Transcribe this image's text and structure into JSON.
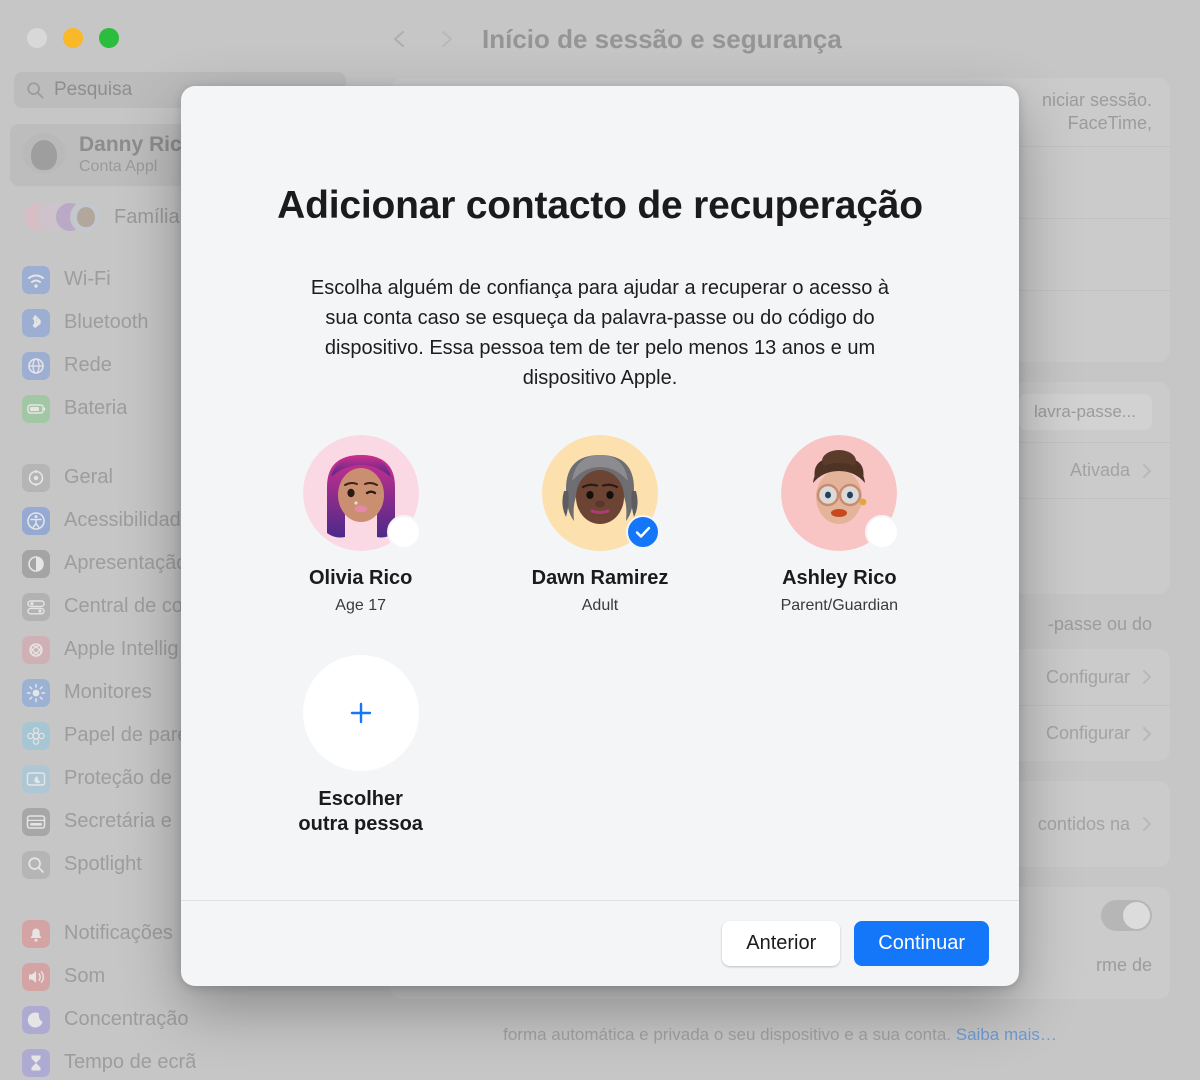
{
  "window": {
    "traffic_lights": [
      "close",
      "minimize",
      "maximize"
    ],
    "search": {
      "placeholder": "Pesquisa",
      "icon": "search-icon"
    },
    "account": {
      "name": "Danny Ric",
      "subtitle": "Conta Appl"
    },
    "family": {
      "label": "Família"
    },
    "sidebar_groups": [
      {
        "items": [
          {
            "label": "Wi-Fi",
            "icon": "wifi-icon",
            "color": "#7a9ede"
          },
          {
            "label": "Bluetooth",
            "icon": "bluetooth-icon",
            "color": "#7a9ede"
          },
          {
            "label": "Rede",
            "icon": "network-globe-icon",
            "color": "#7a9ede"
          },
          {
            "label": "Bateria",
            "icon": "battery-icon",
            "color": "#86c98a"
          }
        ]
      },
      {
        "items": [
          {
            "label": "Geral",
            "icon": "gear-icon",
            "color": "#a8a8a8"
          },
          {
            "label": "Acessibilidade",
            "icon": "accessibility-icon",
            "color": "#6f93dd"
          },
          {
            "label": "Apresentação",
            "icon": "appearance-icon",
            "color": "#8a8a8a"
          },
          {
            "label": "Central de co",
            "icon": "control-center-icon",
            "color": "#a3a3a3"
          },
          {
            "label": "Apple Intellig",
            "icon": "apple-intelligence-icon",
            "color": "#d8a0a8"
          },
          {
            "label": "Monitores",
            "icon": "displays-icon",
            "color": "#7aa3e3"
          },
          {
            "label": "Papel de pare",
            "icon": "wallpaper-icon",
            "color": "#8cc6de"
          },
          {
            "label": "Proteção de",
            "icon": "screensaver-icon",
            "color": "#9cc8e0"
          },
          {
            "label": "Secretária e",
            "icon": "desktop-dock-icon",
            "color": "#8e8e8e"
          },
          {
            "label": "Spotlight",
            "icon": "spotlight-search-icon",
            "color": "#a8a8a8"
          }
        ]
      },
      {
        "items": [
          {
            "label": "Notificações",
            "icon": "notifications-bell-icon",
            "color": "#e08a8a"
          },
          {
            "label": "Som",
            "icon": "sound-speaker-icon",
            "color": "#e08a8a"
          },
          {
            "label": "Concentração",
            "icon": "focus-moon-icon",
            "color": "#9a96dd"
          },
          {
            "label": "Tempo de ecrã",
            "icon": "screen-time-icon",
            "color": "#9a96dd"
          }
        ]
      }
    ],
    "toolbar": {
      "back_icon": "chevron-left-icon",
      "forward_icon": "chevron-right-icon",
      "title": "Início de sessão e segurança"
    },
    "background_rows": {
      "intro_line_1": "niciar sessão.",
      "intro_line_2": "FaceTime,",
      "password_button": "lavra-passe...",
      "status_ativada": "Ativada",
      "partial_text": "-passe ou do",
      "configure_1": "Configurar",
      "configure_2": "Configurar",
      "contained_row": "contidos na",
      "toggle_row_text": "rme de"
    },
    "footnote": {
      "text": "forma automática e privada o seu dispositivo e a sua conta. ",
      "link": "Saiba mais…"
    }
  },
  "dialog": {
    "title": "Adicionar contacto de recuperação",
    "description": "Escolha alguém de confiança para ajudar a recuperar o acesso à sua conta caso se esqueça da palavra-passe ou do código do dispositivo. Essa pessoa tem de ter pelo menos 13 anos e um dispositivo Apple.",
    "people": [
      {
        "name": "Olivia Rico",
        "role": "Age 17",
        "selected": false,
        "avatar_bg": "#fbd9e4"
      },
      {
        "name": "Dawn Ramirez",
        "role": "Adult",
        "selected": true,
        "avatar_bg": "#fce0ae"
      },
      {
        "name": "Ashley Rico",
        "role": "Parent/Guardian",
        "selected": false,
        "avatar_bg": "#f9c5c4"
      }
    ],
    "add_person": {
      "icon": "plus-icon",
      "label_line_1": "Escolher",
      "label_line_2": "outra pessoa"
    },
    "buttons": {
      "back": "Anterior",
      "continue": "Continuar"
    },
    "accent_color": "#1477fa",
    "check_icon": "checkmark-icon"
  }
}
